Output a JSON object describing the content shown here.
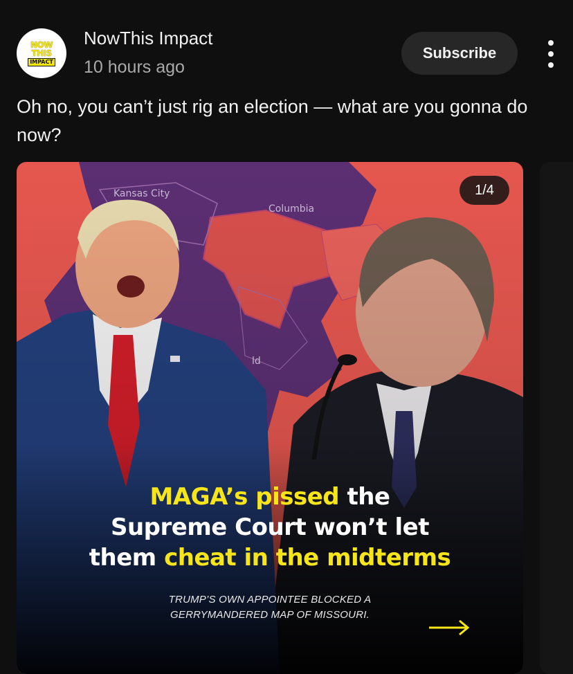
{
  "channel": {
    "name": "NowThis Impact",
    "time": "10 hours ago",
    "logo": {
      "line1": "NOW",
      "line2": "THIS",
      "line3": "IMPACT"
    }
  },
  "subscribe_label": "Subscribe",
  "caption": "Oh no, you can’t just rig an election — what are you gonna do now?",
  "card": {
    "counter": "1/4",
    "map_labels": {
      "kansas_city": "Kansas City",
      "columbia": "Columbia",
      "partial": "ld"
    },
    "headline": {
      "part1": "MAGA’s pissed",
      "part2": " the",
      "part3": "Supreme Court won’t let",
      "part4": "them ",
      "part5": "cheat in the midterms"
    },
    "subhead": {
      "line1": "TRUMP’S OWN APPOINTEE BLOCKED A",
      "line2": "GERRYMANDERED MAP OF MISSOURI."
    }
  },
  "colors": {
    "accent_yellow": "#f7e51c",
    "map_red": "#e5574f",
    "map_purple": "#5b2f72",
    "background": "#0f0f0f"
  }
}
